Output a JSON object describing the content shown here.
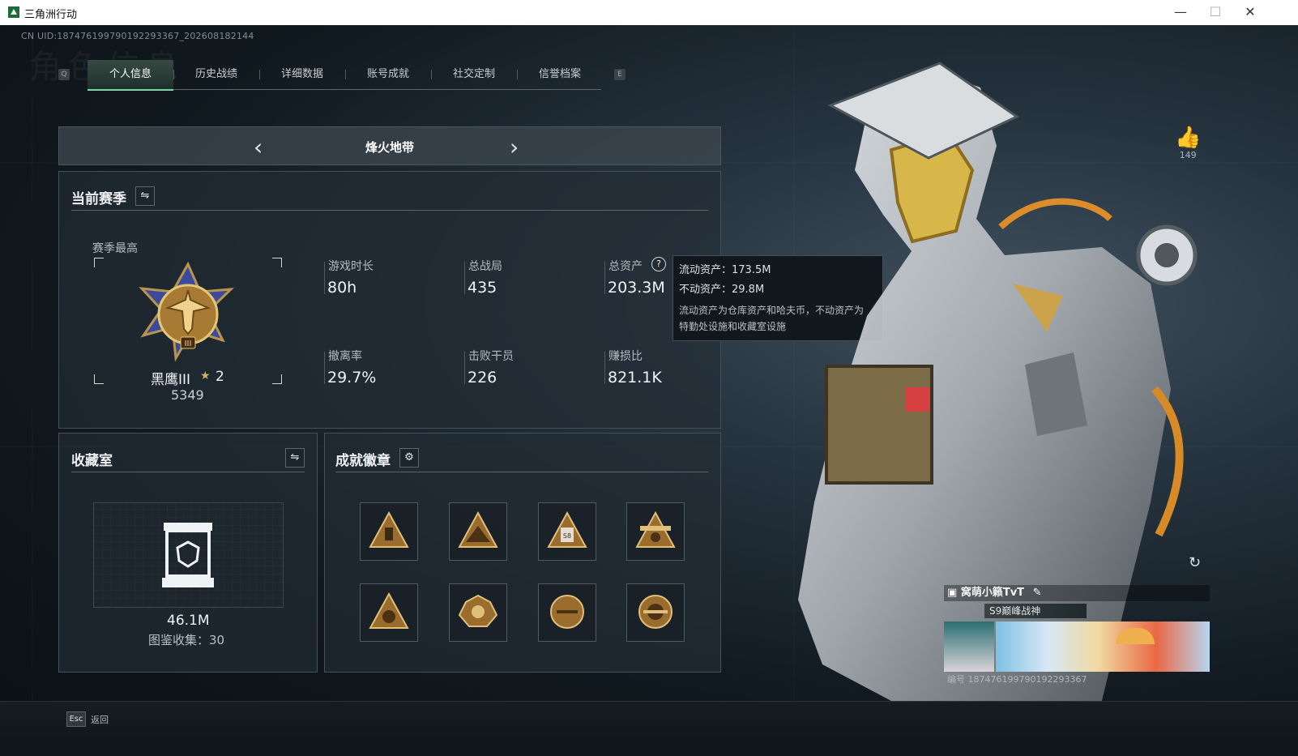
{
  "window": {
    "title": "三角洲行动",
    "minimize": "—",
    "maximize": "☐",
    "close": "✕"
  },
  "header": {
    "uid": "CN UID:187476199790192293367_202608182144",
    "watermark": "角色信息"
  },
  "tabs": {
    "left_key": "Q",
    "right_key": "E",
    "items": [
      "个人信息",
      "历史战绩",
      "详细数据",
      "账号成就",
      "社交定制",
      "信誉档案"
    ],
    "active": 0
  },
  "map": {
    "name": "烽火地带",
    "prev": "‹",
    "next": "›"
  },
  "season": {
    "title": "当前赛季",
    "highest_label": "赛季最高",
    "rank_name": "黑鹰III",
    "stars": "2",
    "score": "5349",
    "stats": [
      {
        "label": "游戏时长",
        "value": "80h"
      },
      {
        "label": "总战局",
        "value": "435"
      },
      {
        "label": "总资产",
        "value": "203.3M"
      },
      {
        "label": "撤离率",
        "value": "29.7%"
      },
      {
        "label": "击败干员",
        "value": "226"
      },
      {
        "label": "赚损比",
        "value": "821.1K"
      }
    ],
    "help_icon": "?"
  },
  "tooltip": {
    "line1": "流动资产：173.5M",
    "line2": "不动资产：29.8M",
    "desc1": "流动资产为仓库资产和哈夫币，不动资产为",
    "desc2": "特勤处设施和收藏室设施"
  },
  "collection": {
    "title": "收藏室",
    "value": "46.1M",
    "label": "图鉴收集：30"
  },
  "badges": {
    "title": "成就徽章",
    "count": 8
  },
  "profile": {
    "likes": "149",
    "name": "窝萌小籁TvT",
    "title": "S9巅峰战神",
    "id": "编号 187476199790192293367"
  },
  "footer": {
    "esc": "Esc",
    "back": "返回"
  },
  "colors": {
    "accent": "#7dd6a4",
    "gold": "#c89a48",
    "panel": "#232d35"
  }
}
